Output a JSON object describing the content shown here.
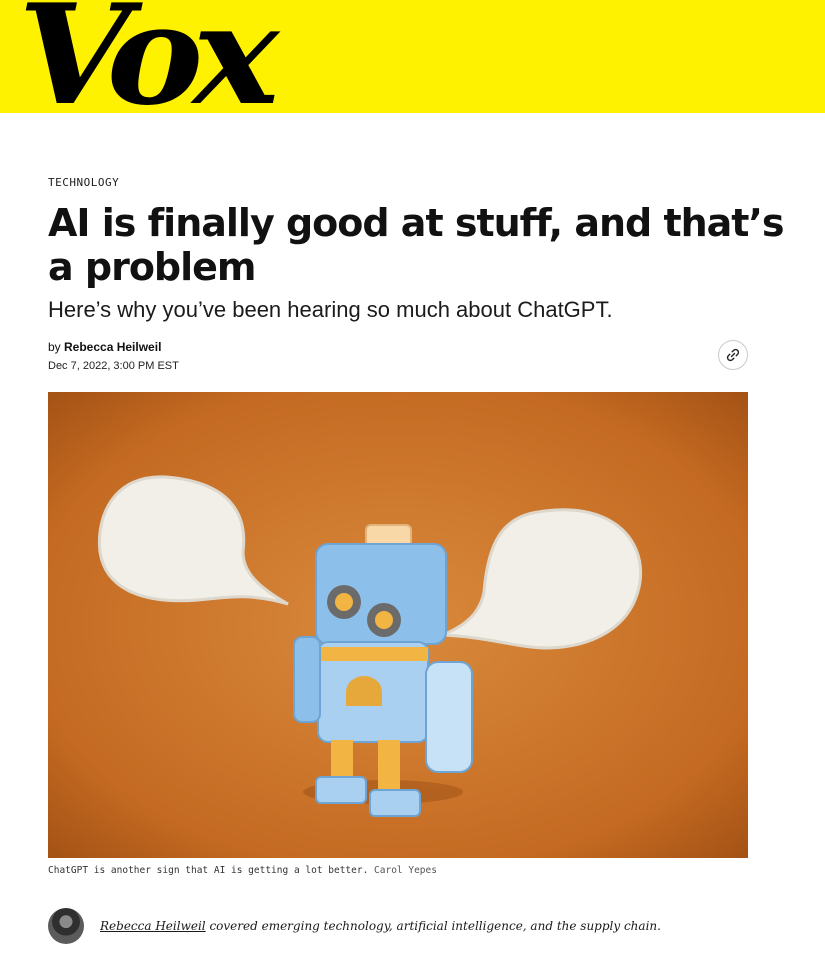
{
  "site": {
    "logo_text": "Vox",
    "brand_color": "#fff200"
  },
  "article": {
    "kicker": "TECHNOLOGY",
    "headline": "AI is finally good at stuff, and that’s a problem",
    "dek": "Here’s why you’ve been hearing so much about ChatGPT.",
    "byline_prefix": "by ",
    "author": "Rebecca Heilweil",
    "date": "Dec 7, 2022, 3:00 PM EST",
    "copy_link_icon": "link-icon"
  },
  "hero": {
    "caption": "ChatGPT is another sign that AI is getting a lot better.",
    "credit": "Carol Yepes"
  },
  "bio": {
    "author_link": "Rebecca Heilweil",
    "text": " covered emerging technology, artificial intelligence, and the supply chain."
  }
}
